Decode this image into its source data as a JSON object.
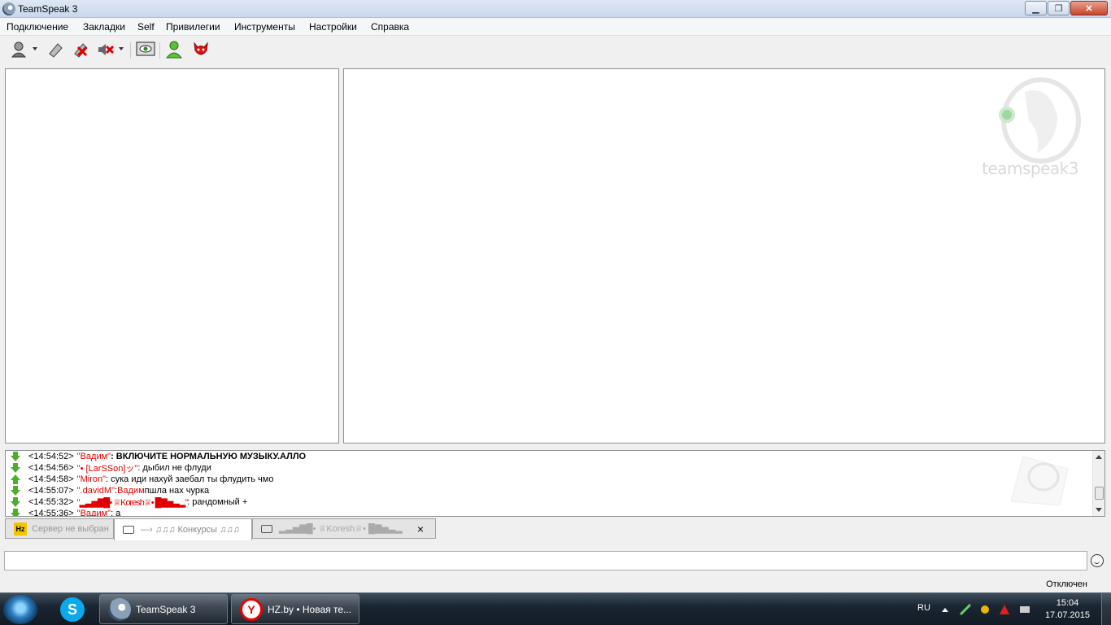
{
  "window": {
    "title": "TeamSpeak 3"
  },
  "menu": [
    "Подключение",
    "Закладки",
    "Self",
    "Привилегии",
    "Инструменты",
    "Настройки",
    "Справка"
  ],
  "info_panel": {
    "logo_text": "teamspeak3"
  },
  "chat": {
    "lines": [
      {
        "arrow": "down",
        "time": "<14:54:52>",
        "nick": "\"Вадим\"",
        "text": ": ВКЛЮЧИТЕ НОРМАЛЬНУЮ МУЗЫКУ.АЛЛО",
        "bold": true
      },
      {
        "arrow": "down",
        "time": "<14:54:56>",
        "nick": "\"• [LarSSon]ッ\"",
        "text": ": дыбил не флуди",
        "bold": false
      },
      {
        "arrow": "up",
        "time": "<14:54:58>",
        "nick": "\"Miron\"",
        "text": ": сука иди нахуй заебал ты флудить чмо",
        "bold": false
      },
      {
        "arrow": "down",
        "time": "<14:55:07>",
        "nick": "\".davidM\"",
        "text": ": ",
        "mention": "Вадим",
        "text2": " пшла нах чурка",
        "bold": false
      },
      {
        "arrow": "down",
        "time": "<14:55:32>",
        "nick": "\"▂▃▅▇█• ♕Koresh♕• █▇▅▃▂\"",
        "text": ": рандомный +",
        "bold": false
      },
      {
        "arrow": "down",
        "time": "<14:55:36>",
        "nick": "\"Вадим\"",
        "text": ": а",
        "bold": false
      }
    ]
  },
  "tabs": [
    {
      "label": "Сервер не выбран",
      "icon": "hz-icon"
    },
    {
      "label": "—› ♫♫♫ Конкурсы ♫♫♫",
      "icon": "chat-bubble-icon"
    },
    {
      "label": "▂▃▅▇█• ♕Koresh♕• █▇▅▃▂",
      "icon": "chat-bubble-icon",
      "close": "×"
    }
  ],
  "input": {
    "value": ""
  },
  "status": {
    "text": "Отключен"
  },
  "taskbar": {
    "tasks": [
      {
        "label": "TeamSpeak 3"
      },
      {
        "label": "HZ.by • Новая те..."
      }
    ],
    "lang": "RU",
    "time": "15:04",
    "date": "17.07.2015"
  }
}
